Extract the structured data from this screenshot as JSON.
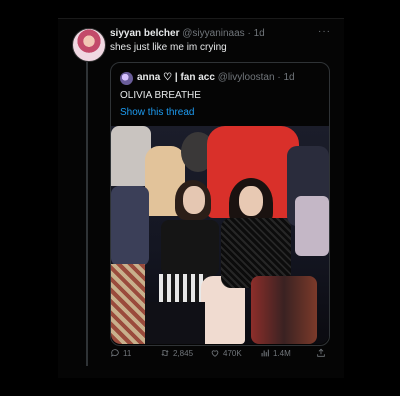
{
  "tweet": {
    "display_name": "siyyan belcher",
    "handle": "@siyyaninaas",
    "time": "1d",
    "text": "shes just like me im crying",
    "more_label": "···"
  },
  "quoted": {
    "display_name": "anna ♡ | fan acc",
    "handle": "@livyloostan",
    "time": "1d",
    "text": "OLIVIA BREATHE",
    "link": "Show this thread"
  },
  "actions": {
    "replies": "11",
    "retweets": "2,845",
    "likes": "470K",
    "views": "1.4M"
  },
  "colors": {
    "accent": "#1d9bf0",
    "muted": "#71767b",
    "text": "#e7e9ea",
    "background": "#000000"
  }
}
